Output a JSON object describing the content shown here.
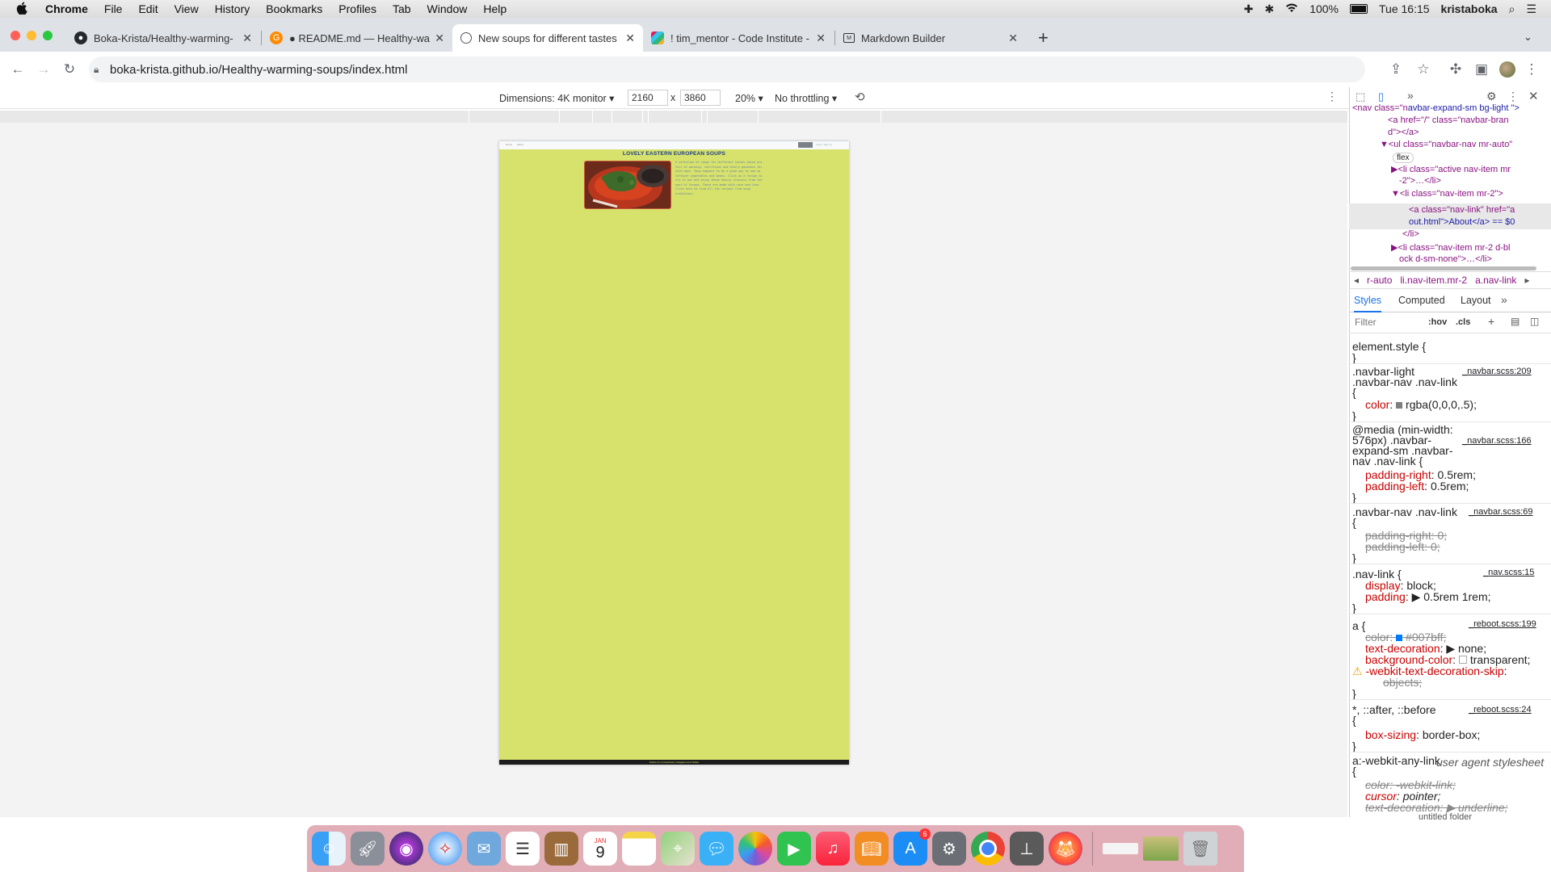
{
  "menubar": {
    "app": "Chrome",
    "items": [
      "File",
      "Edit",
      "View",
      "History",
      "Bookmarks",
      "Profiles",
      "Tab",
      "Window",
      "Help"
    ],
    "battery": "100%",
    "clock": "Tue 16:15",
    "user": "kristaboka"
  },
  "tabs": [
    {
      "title": "Boka-Krista/Healthy-warming-",
      "icon": "github-icon"
    },
    {
      "title": "● README.md — Healthy-war",
      "icon": "gitpod-icon"
    },
    {
      "title": "New soups for different tastes",
      "icon": "globe-icon",
      "active": true
    },
    {
      "title": "! tim_mentor - Code Institute -",
      "icon": "slack-icon"
    },
    {
      "title": "Markdown Builder",
      "icon": "markdown-icon"
    }
  ],
  "address": {
    "url": "boka-krista.github.io/Healthy-warming-soups/index.html"
  },
  "device_toolbar": {
    "dimensions_label": "Dimensions: 4K monitor ▾",
    "width": "2160",
    "times": "x",
    "height": "3860",
    "zoom": "20% ▾",
    "throttling": "No throttling ▾"
  },
  "site": {
    "nav_items": [
      "Home",
      "About"
    ],
    "nav_right": "Login  |  Sign up",
    "title": "LOVELY EASTERN EUROPEAN SOUPS",
    "body_text": "A selection of soups for different tastes which are full of warming, nutritious and hearty goodness for cold days. Soup happens to be a good way to use up leftover vegetables and beans. Click on a recipe to try it out and enjoy these hearty classics from the east of Europe. These are made with care and love. Click here to find all the recipes from soup traditions.",
    "footer": "Follow us on Facebook, Instagram and Twitter"
  },
  "devtools": {
    "dom_lines": [
      "avbar-expand-sm bg-light \">",
      "<a href=\"/\" class=\"navbar-bran",
      "d\"></a>",
      "▼<ul class=\"navbar-nav mr-auto\"",
      "flex",
      "▶<li class=\"active nav-item mr",
      "-2\">…</li>",
      "▼<li class=\"nav-item mr-2\">",
      "<a class=\"nav-link\" href=\"a",
      "out.html\">About</a> == $0",
      "</li>",
      "▶<li class=\"nav-item mr-2 d-bl",
      "ock d-sm-none\">…</li>"
    ],
    "breadcrumb": [
      "r-auto",
      "li.nav-item.mr-2",
      "a.nav-link"
    ],
    "panel_tabs": [
      "Styles",
      "Computed",
      "Layout"
    ],
    "filter_placeholder": "Filter",
    "hov": ":hov",
    "cls": ".cls",
    "rules": [
      {
        "sel": "element.style {",
        "src": "",
        "props": []
      },
      {
        "sel": ".navbar-light .navbar-nav .nav-link {",
        "src": "_navbar.scss:209",
        "props": [
          {
            "p": "color",
            "v": "rgba(0,0,0,.5);"
          }
        ]
      },
      {
        "sel": "@media (min-width: 576px) .navbar-expand-sm .navbar-nav .nav-link {",
        "src": "_navbar.scss:166",
        "props": [
          {
            "p": "padding-right",
            "v": "0.5rem;"
          },
          {
            "p": "padding-left",
            "v": "0.5rem;"
          }
        ]
      },
      {
        "sel": ".navbar-nav .nav-link {",
        "src": "_navbar.scss:69",
        "props": [
          {
            "p": "padding-right",
            "v": "0;",
            "strike": true
          },
          {
            "p": "padding-left",
            "v": "0;",
            "strike": true
          }
        ]
      },
      {
        "sel": ".nav-link {",
        "src": "_nav.scss:15",
        "props": [
          {
            "p": "display",
            "v": "block;"
          },
          {
            "p": "padding",
            "v": "▶ 0.5rem 1rem;"
          }
        ]
      },
      {
        "sel": "a {",
        "src": "_reboot.scss:199",
        "props": [
          {
            "p": "color",
            "v": "#007bff;",
            "strike": true
          },
          {
            "p": "text-decoration",
            "v": "▶ none;"
          },
          {
            "p": "background-color",
            "v": "transparent;"
          },
          {
            "p": "-webkit-text-decoration-skip",
            "v": "objects;",
            "warn": true
          }
        ]
      },
      {
        "sel": "*, ::after, ::before {",
        "src": "_reboot.scss:24",
        "props": [
          {
            "p": "box-sizing",
            "v": "border-box;"
          }
        ]
      },
      {
        "sel": "a:-webkit-any-link {",
        "src": "user agent stylesheet",
        "props": [
          {
            "p": "color",
            "v": "-webkit-link;",
            "strike": true
          },
          {
            "p": "cursor",
            "v": "pointer;"
          },
          {
            "p": "text-decoration",
            "v": "▶ underline;",
            "strike": true
          }
        ]
      }
    ]
  },
  "dock": {
    "untitled_folder": "untitled folder",
    "calendar_month": "JAN",
    "calendar_day": "9",
    "appstore_badge": "6"
  },
  "colors": {
    "site_bg": "#d6e26c",
    "site_title": "#1e3a8a",
    "tab_strip": "#dee1e6",
    "devtools_selection": "#e8e8e8"
  }
}
